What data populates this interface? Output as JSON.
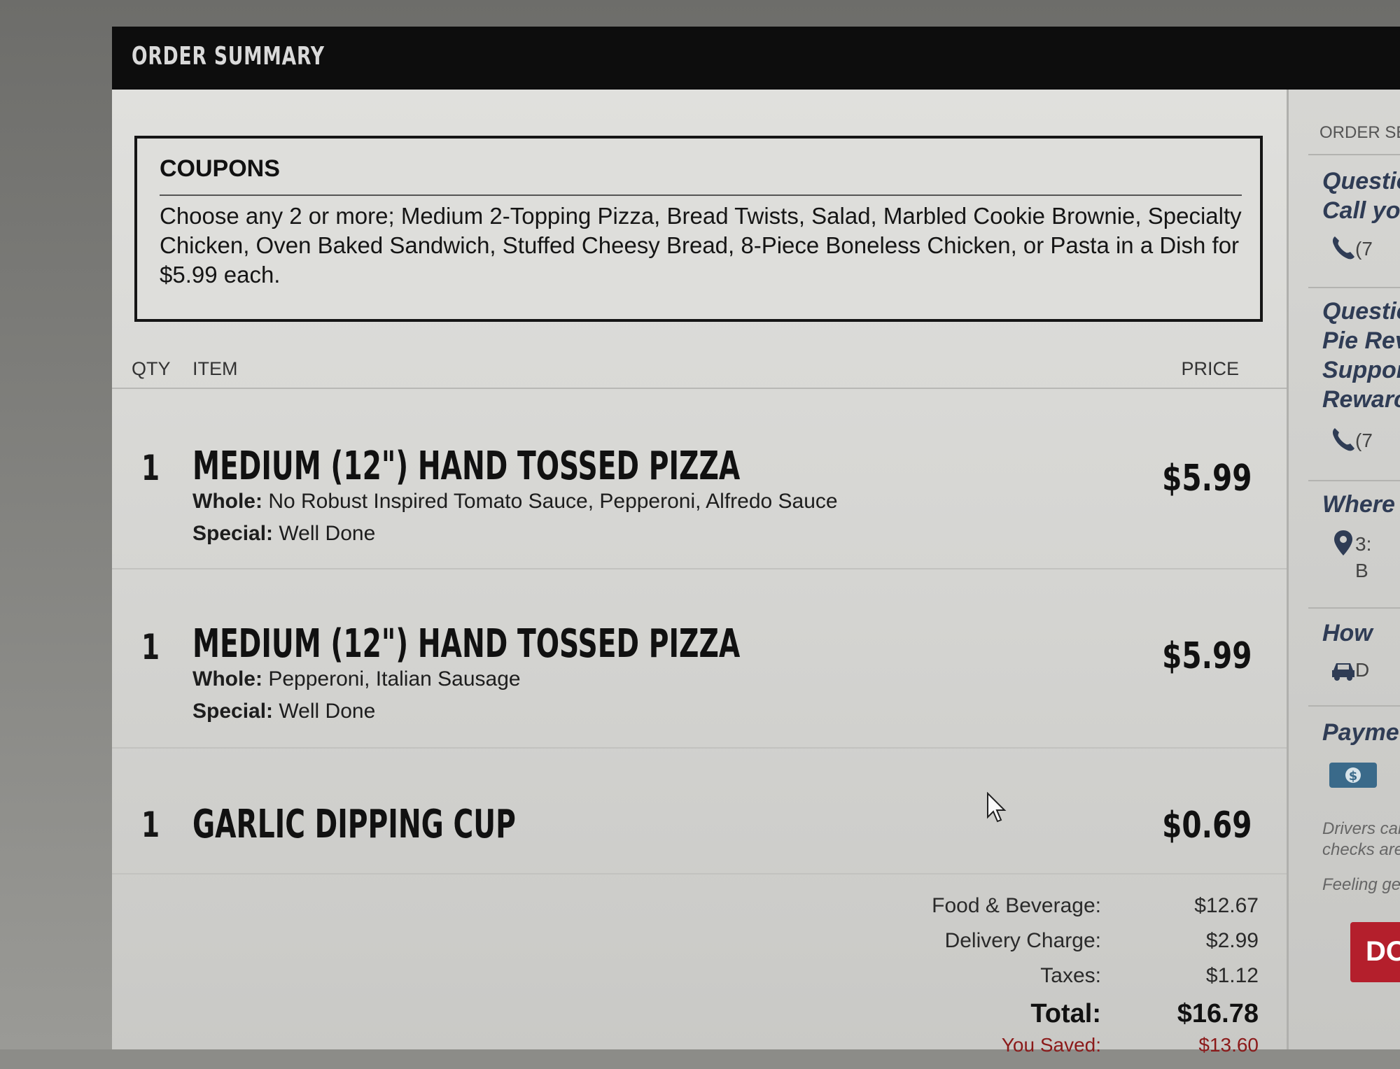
{
  "header": {
    "title": "ORDER SUMMARY"
  },
  "coupons": {
    "title": "COUPONS",
    "description": "Choose any 2 or more; Medium 2-Topping Pizza, Bread Twists, Salad, Marbled Cookie Brownie, Specialty Chicken, Oven Baked Sandwich, Stuffed Cheesy Bread, 8-Piece Boneless Chicken, or Pasta in a Dish for $5.99 each."
  },
  "columns": {
    "qty": "QTY",
    "item": "ITEM",
    "price": "PRICE"
  },
  "items": [
    {
      "qty": "1",
      "name": "MEDIUM (12\") HAND TOSSED PIZZA",
      "whole_label": "Whole:",
      "whole_value": "No Robust Inspired Tomato Sauce, Pepperoni, Alfredo Sauce",
      "special_label": "Special:",
      "special_value": "Well Done",
      "price": "$5.99"
    },
    {
      "qty": "1",
      "name": "MEDIUM (12\") HAND TOSSED PIZZA",
      "whole_label": "Whole:",
      "whole_value": "Pepperoni, Italian Sausage",
      "special_label": "Special:",
      "special_value": "Well Done",
      "price": "$5.99"
    },
    {
      "qty": "1",
      "name": "GARLIC DIPPING CUP",
      "price": "$0.69"
    }
  ],
  "totals": {
    "food_label": "Food & Beverage:",
    "food_value": "$12.67",
    "delivery_label": "Delivery Charge:",
    "delivery_value": "$2.99",
    "taxes_label": "Taxes:",
    "taxes_value": "$1.12",
    "total_label": "Total:",
    "total_value": "$16.78",
    "saved_label": "You Saved:",
    "saved_value": "$13.60"
  },
  "sidebar": {
    "eyebrow": "ORDER SE",
    "q1_line1": "Questio",
    "q1_line2": "Call you",
    "phone1": "(7",
    "q2_line1": "Questic",
    "q2_line2": "Pie Rev",
    "q2_line3": "Suppor",
    "q2_line4": "Rewarc",
    "phone2": "(7",
    "where": "Where",
    "address1": "3:",
    "address2": "B",
    "how": "How",
    "method": "D",
    "payment": "Payme",
    "drivers_line1": "Drivers can",
    "drivers_line2": "checks are",
    "feeling": "Feeling gen",
    "cta": "DO"
  },
  "icons": [
    "phone-icon",
    "phone-icon",
    "map-pin-icon",
    "car-icon",
    "cash-icon",
    "cursor-icon"
  ]
}
